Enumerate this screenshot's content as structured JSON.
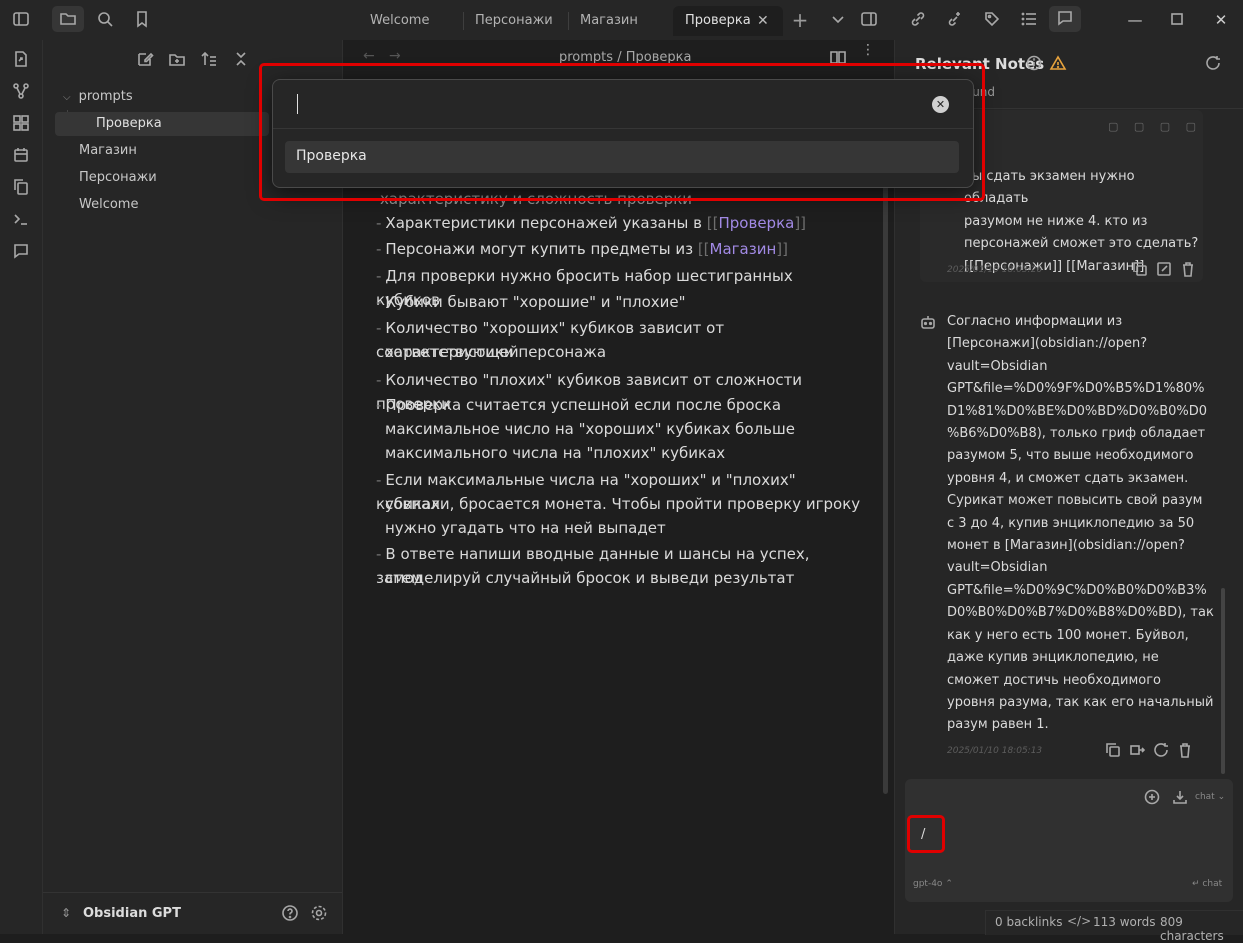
{
  "tabs": [
    {
      "label": "Welcome",
      "active": false
    },
    {
      "label": "Персонажи",
      "active": false
    },
    {
      "label": "Магазин",
      "active": false
    },
    {
      "label": "Проверка",
      "active": true
    }
  ],
  "explorer": {
    "folder": "prompts",
    "items": [
      "Проверка",
      "Магазин",
      "Персонажи",
      "Welcome"
    ],
    "vault_name": "Obsidian GPT"
  },
  "editor": {
    "breadcrumb_folder": "prompts",
    "breadcrumb_sep": "/",
    "breadcrumb_file": "Проверка",
    "partial_line": "характеристику и сложность проверки",
    "lines": [
      {
        "pre": "Характеристики персонажей указаны в ",
        "link": "Проверка"
      },
      {
        "pre": "Персонажи могут купить предметы из ",
        "link": "Магазин"
      },
      {
        "text": "Для проверки нужно бросить набор шестигранных кубиков"
      },
      {
        "text": "Кубики бывают \"хорошие\" и \"плохие\""
      },
      {
        "text": "Количество \"хороших\" кубиков зависит от соответствующей"
      },
      {
        "text": "характеристики персонажа"
      },
      {
        "text": "Количество \"плохих\" кубиков зависит от сложности проверки"
      },
      {
        "text": "Проверка считается успешной если после броска"
      },
      {
        "text": "максимальное число на \"хороших\" кубиках больше"
      },
      {
        "text": "максимального числа на \"плохих\" кубиках"
      },
      {
        "text": "Если максимальные числа на \"хороших\" и \"плохих\" кубиках"
      },
      {
        "text": "совпали, бросается монета. Чтобы пройти проверку игроку"
      },
      {
        "text": "нужно угадать что на ней выпадет"
      },
      {
        "text": "В ответе напиши вводные данные и шансы на успех, затем"
      },
      {
        "text": "смоделируй случайный бросок и выведи результат"
      }
    ]
  },
  "switcher": {
    "input_value": "",
    "result": "Проверка"
  },
  "panel": {
    "title": "Relevant Notes",
    "subtitle": "t notes found",
    "user_msg_lines": [
      "бы сдать экзамен нужно обладать",
      "разумом не ниже 4. кто из",
      "персонажей сможет это сделать?",
      "[[Персонажи]] [[Магазин]]"
    ],
    "user_ts": "2025/01/10 18:03:26",
    "bot_msg_lines": [
      "Согласно информации из",
      "[Персонажи](obsidian://open?",
      "vault=Obsidian",
      "GPT&file=%D0%9F%D0%B5%D1%80%",
      "D1%81%D0%BE%D0%BD%D0%B0%D0",
      "%B6%D0%B8), только гриф обладает",
      "разумом 5, что выше необходимого",
      "уровня 4, и сможет сдать экзамен.",
      "Сурикат может повысить свой разум",
      "с 3 до 4, купив энциклопедию за 50",
      "монет в [Магазин](obsidian://open?",
      "vault=Obsidian",
      "GPT&file=%D0%9C%D0%B0%D0%B3%",
      "D0%B0%D0%B7%D0%B8%D0%BD), так",
      "как у него есть 100 монет. Буйвол,",
      "даже купив энциклопедию, не",
      "сможет достичь необходимого",
      "уровня разума, так как его начальный",
      "разум равен 1."
    ],
    "bot_ts": "2025/01/10 18:05:13",
    "chat_mode": "chat",
    "input_value": "/",
    "model": "gpt-4o",
    "send_label": "chat"
  },
  "status": {
    "backlinks": "0 backlinks",
    "words": "113 words",
    "characters": "809 characters"
  }
}
